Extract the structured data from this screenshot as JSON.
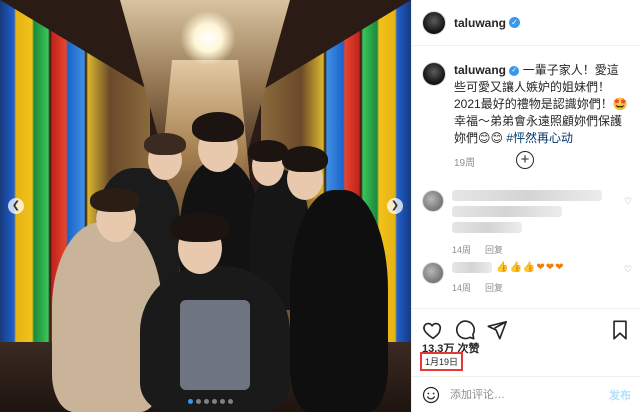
{
  "post": {
    "username": "taluwang",
    "caption_text": "一輩子家人！愛這些可愛又讓人嫉妒的姐妹們！2021最好的禮物是認識妳們！🤩幸福～弟弟會永遠照顧妳們保護妳們😊😊",
    "hashtag": "#怦然再心动",
    "caption_time": "19周",
    "likes": "13.3万 次赞",
    "date": "1月19日"
  },
  "comments": [
    {
      "time": "14周",
      "reply": "回复",
      "emojis": [
        "👍",
        "👍",
        "👍",
        "❤",
        "❤",
        "❤"
      ]
    },
    {
      "time": "14周",
      "reply": "回复",
      "emojis": [
        "👍",
        "👍",
        "👍",
        "❤",
        "❤",
        "❤"
      ]
    }
  ],
  "add_comment": {
    "placeholder": "添加评论…",
    "post_label": "发布"
  },
  "carousel": {
    "total": 6,
    "active_index": 0
  },
  "colors": {
    "accent": "#3897f0",
    "date_highlight": "#e53935",
    "link": "#00376b"
  },
  "icons": [
    "heart-icon",
    "comment-icon",
    "share-icon",
    "bookmark-icon",
    "smile-icon",
    "plus-circle-icon",
    "verified-icon"
  ]
}
